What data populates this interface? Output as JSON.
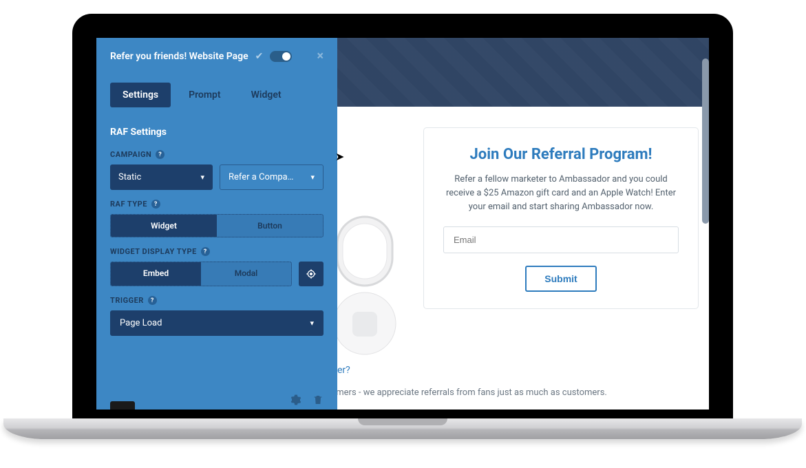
{
  "panel": {
    "title": "Refer you friends! Website Page",
    "tabs": [
      "Settings",
      "Prompt",
      "Widget"
    ],
    "active_tab": 0,
    "section_title": "RAF Settings",
    "labels": {
      "campaign": "CAMPAIGN",
      "raf_type": "RAF TYPE",
      "widget_display_type": "WIDGET DISPLAY TYPE",
      "trigger": "TRIGGER"
    },
    "campaign": {
      "mode": "Static",
      "selected": "Refer a Compa…"
    },
    "raf_type": {
      "options": [
        "Widget",
        "Button"
      ],
      "active": 0
    },
    "display_type": {
      "options": [
        "Embed",
        "Modal"
      ],
      "active": 0
    },
    "trigger": {
      "selected": "Page Load"
    }
  },
  "preview": {
    "card": {
      "heading": "Join Our Referral Program!",
      "body": "Refer a fellow marketer to Ambassador and you could receive a $25 Amazon gift card and an Apple Watch! Enter your email and start sharing Ambassador now.",
      "email_placeholder": "Email",
      "submit_label": "Submit"
    },
    "link_fragment": "er?",
    "body_fragment": "stomers - we appreciate referrals from fans just as much as customers."
  }
}
